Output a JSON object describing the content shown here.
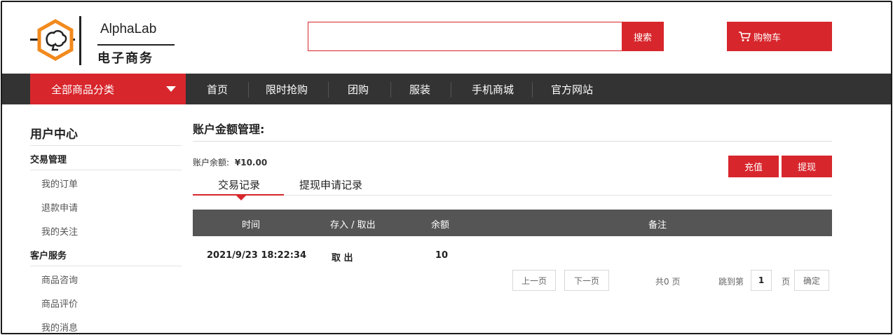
{
  "header": {
    "brand_title": "AlphaLab",
    "brand_subtitle": "电子商务",
    "search": {
      "value": "",
      "placeholder": "",
      "button_label": "搜索"
    },
    "cart_label": "购物车"
  },
  "nav": {
    "category_label": "全部商品分类",
    "items": [
      "首页",
      "限时抢购",
      "团购",
      "服装",
      "手机商城",
      "官方网站"
    ]
  },
  "sidebar": {
    "title": "用户中心",
    "groups": [
      {
        "label": "交易管理",
        "links": [
          "我的订单",
          "退款申请",
          "我的关注"
        ]
      },
      {
        "label": "客户服务",
        "links": [
          "商品咨询",
          "商品评价",
          "我的消息"
        ]
      }
    ]
  },
  "main": {
    "title": "账户金额管理:",
    "balance_label": "账户余额:",
    "balance_value": "¥10.00",
    "recharge_label": "充值",
    "withdraw_label": "提现",
    "tabs": [
      "交易记录",
      "提现申请记录"
    ],
    "active_tab": "交易记录",
    "table": {
      "columns": [
        "时间",
        "存入 / 取出",
        "余额",
        "备注"
      ],
      "rows": [
        {
          "time": "2021/9/23 18:22:34",
          "type": "取 出",
          "balance": "10",
          "note": ""
        }
      ]
    },
    "pager": {
      "prev_label": "上一页",
      "next_label": "下一页",
      "total_label": "共0 页",
      "jump_label": "跳到第",
      "page_value": "1",
      "page_unit": "页",
      "confirm_label": "确定"
    }
  },
  "colors": {
    "accent": "#d7262c",
    "nav_bg": "#333333",
    "table_header_bg": "#555555"
  }
}
